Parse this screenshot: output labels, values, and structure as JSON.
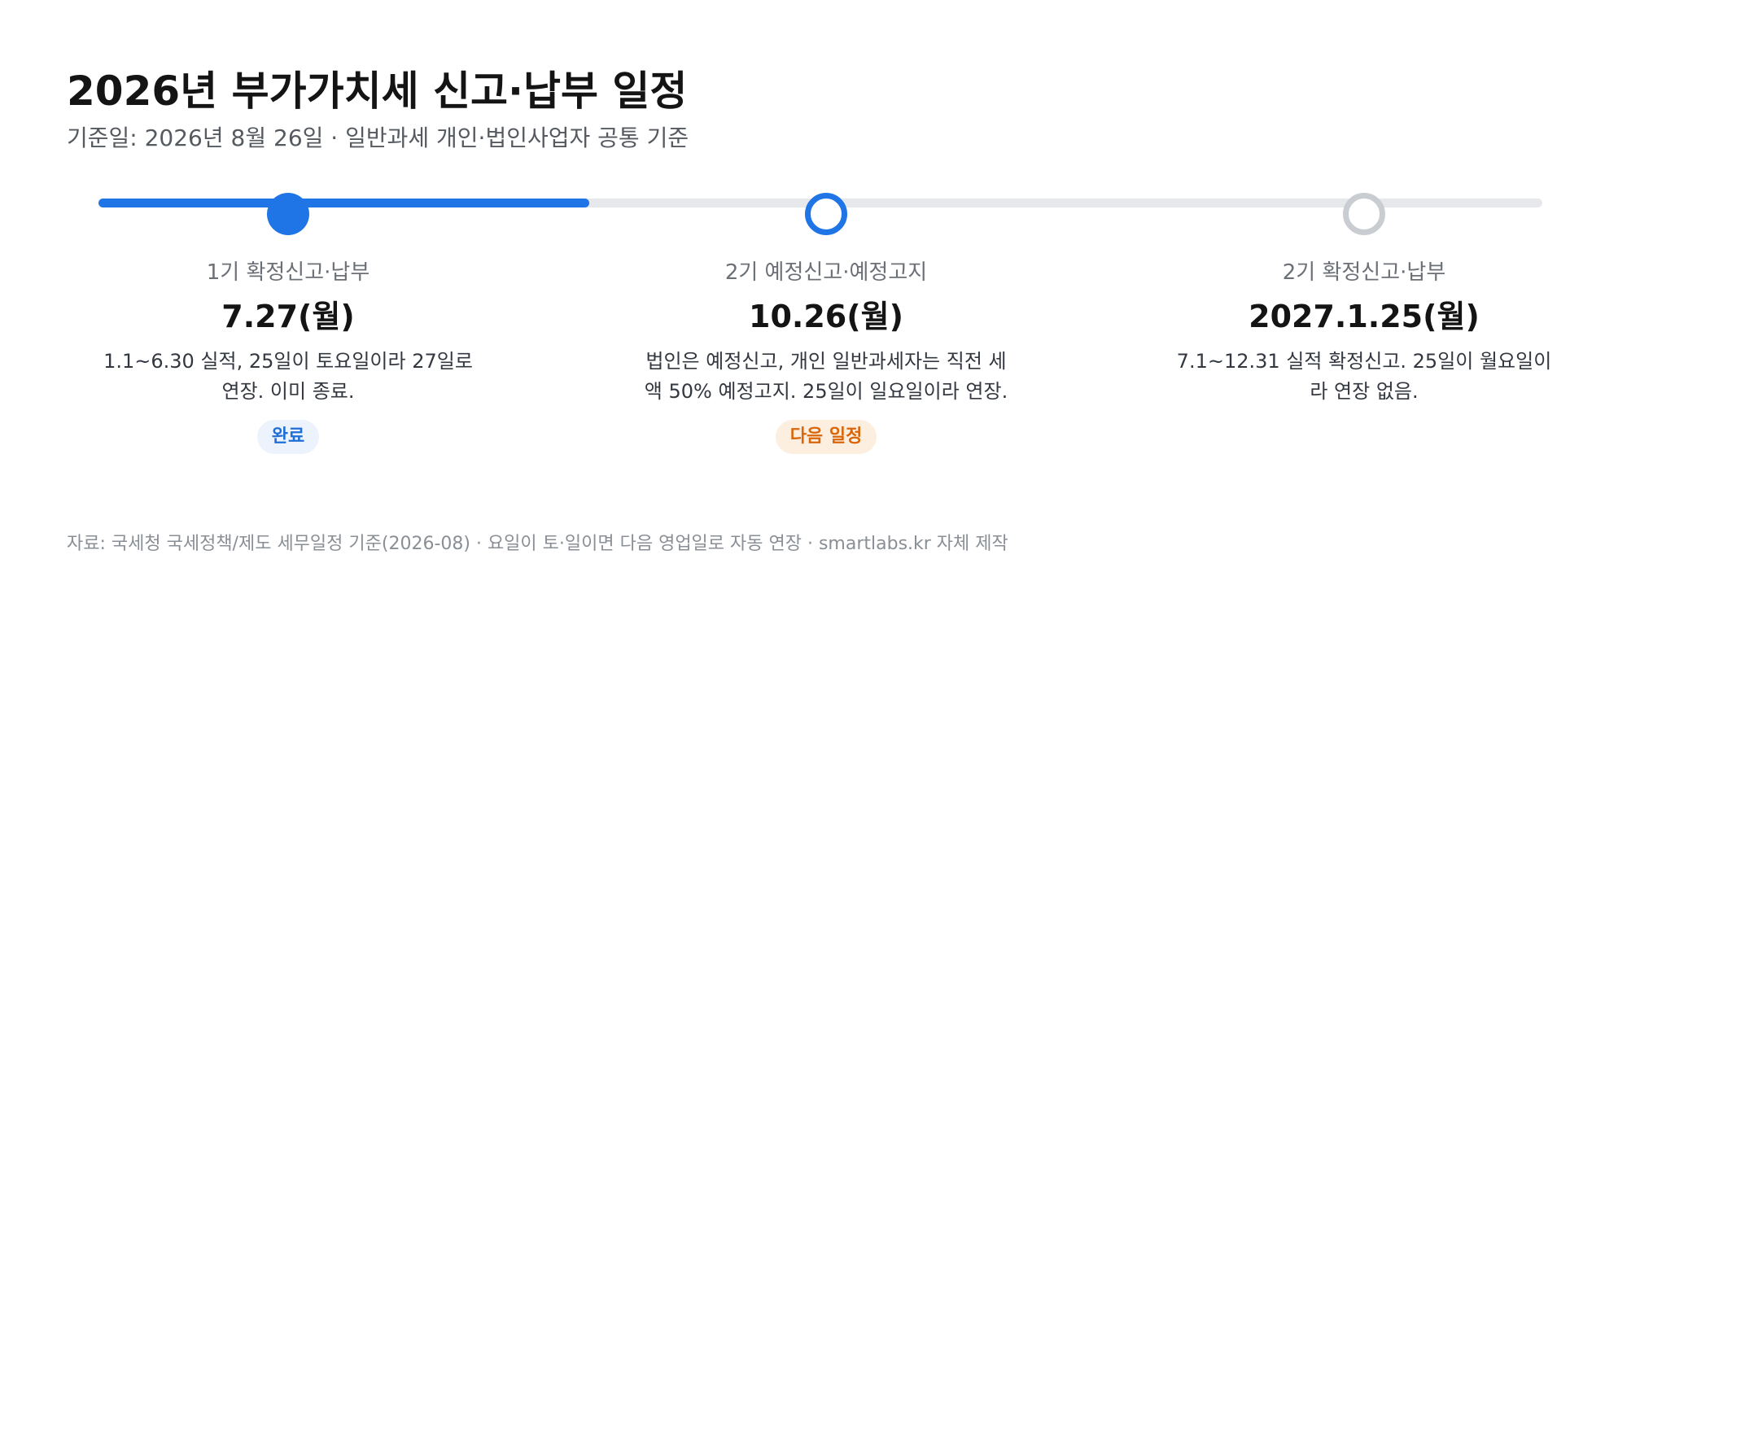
{
  "header": {
    "title": "2026년 부가가치세 신고·납부 일정",
    "subtitle": "기준일: 2026년 8월 26일 · 일반과세 개인·법인사업자 공통 기준"
  },
  "timeline": {
    "progress_percent": 34,
    "stages": [
      {
        "label": "1기 확정신고·납부",
        "date": "7.27(월)",
        "description": "1.1~6.30 실적, 25일이 토요일이라 27일로 연장. 이미 종료.",
        "status": "done",
        "badge": "완료",
        "badge_color": "#1f6fd6",
        "badge_bg": "#edf3fc"
      },
      {
        "label": "2기 예정신고·예정고지",
        "date": "10.26(월)",
        "description": "법인은 예정신고, 개인 일반과세자는 직전 세액 50% 예정고지. 25일이 일요일이라 연장.",
        "status": "next",
        "badge": "다음 일정",
        "badge_color": "#d9660b",
        "badge_bg": "#fdefe0"
      },
      {
        "label": "2기 확정신고·납부",
        "date": "2027.1.25(월)",
        "description": "7.1~12.31 실적 확정신고. 25일이 월요일이라 연장 없음.",
        "status": "future"
      }
    ]
  },
  "footer": {
    "source": "자료: 국세청 국세정책/제도 세무일정 기준(2026-08) · 요일이 토·일이면 다음 영업일로 자동 연장 · smartlabs.kr 자체 제작"
  },
  "colors": {
    "accent": "#1f74e6",
    "track": "#e6e8eb",
    "inactive_node": "#c9ccd1"
  }
}
